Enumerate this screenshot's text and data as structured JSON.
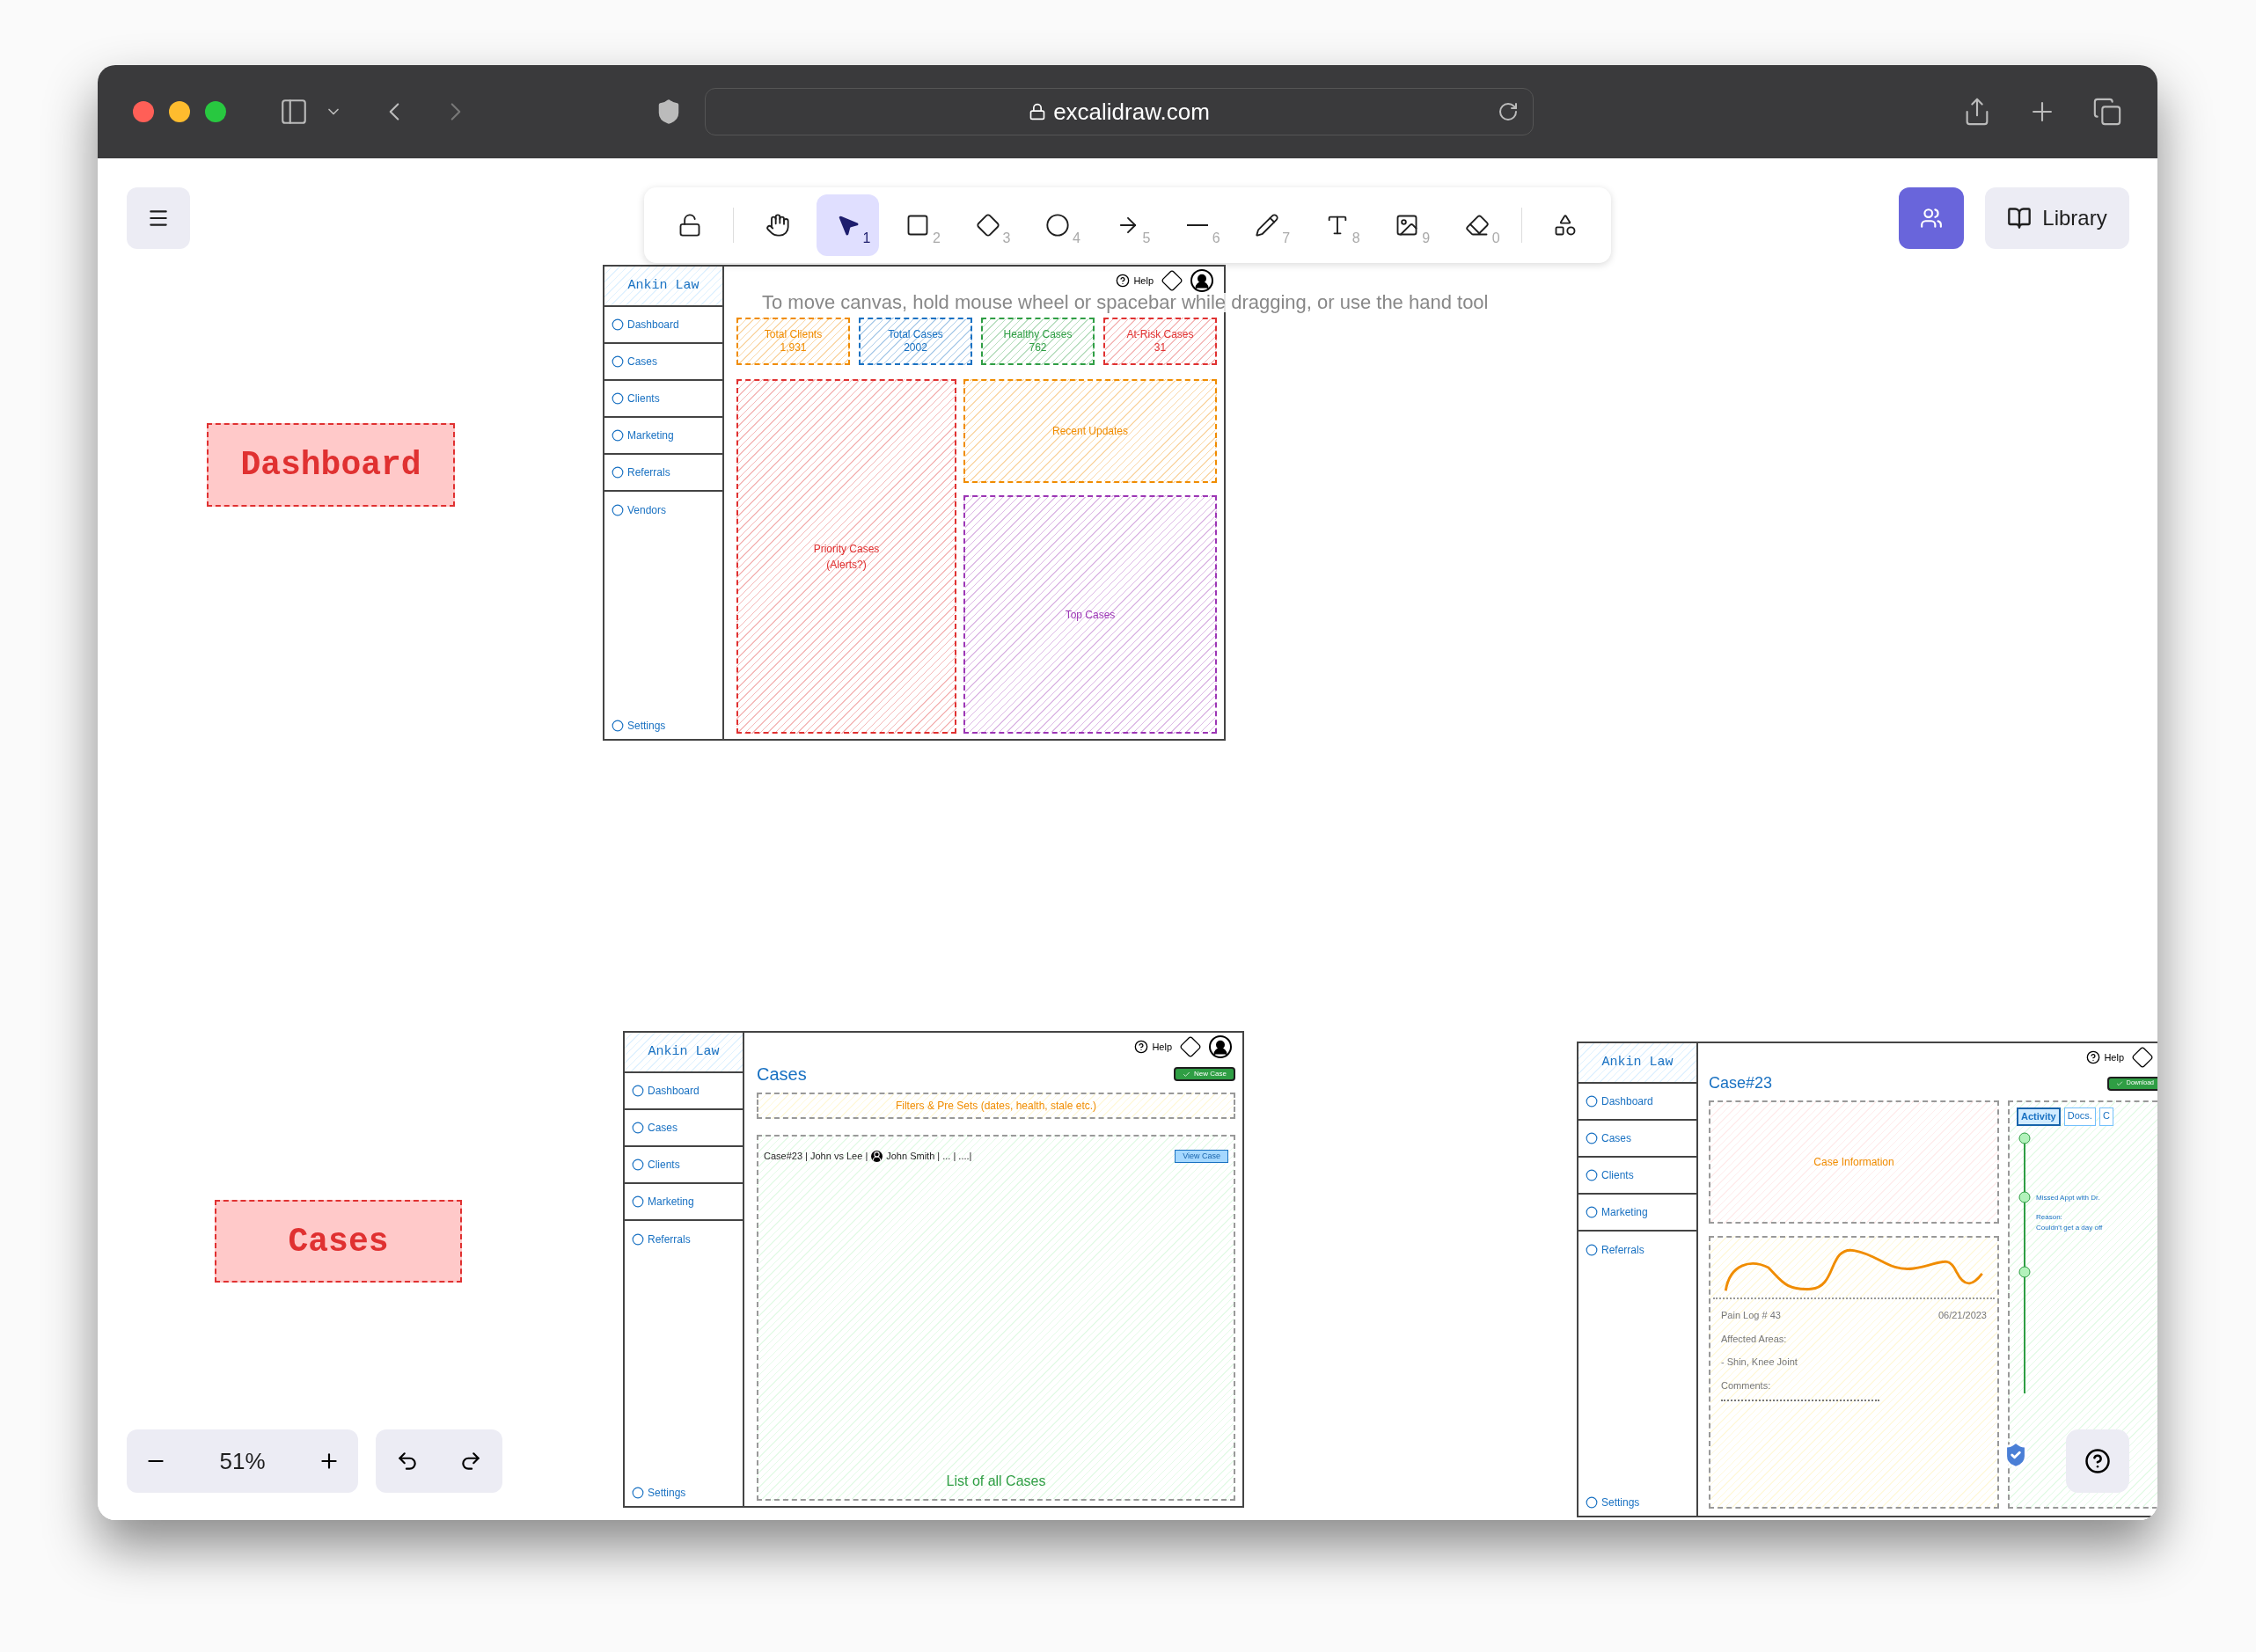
{
  "browser": {
    "url": "excalidraw.com"
  },
  "toolbar": {
    "tools": [
      {
        "kind": "lock",
        "selected": false
      },
      {
        "kind": "hand",
        "selected": false
      },
      {
        "kind": "select",
        "shortcut": "1",
        "selected": true
      },
      {
        "kind": "rectangle",
        "shortcut": "2",
        "selected": false
      },
      {
        "kind": "diamond",
        "shortcut": "3",
        "selected": false
      },
      {
        "kind": "ellipse",
        "shortcut": "4",
        "selected": false
      },
      {
        "kind": "arrow",
        "shortcut": "5",
        "selected": false
      },
      {
        "kind": "line",
        "shortcut": "6",
        "selected": false
      },
      {
        "kind": "pencil",
        "shortcut": "7",
        "selected": false
      },
      {
        "kind": "text",
        "shortcut": "8",
        "selected": false
      },
      {
        "kind": "image",
        "shortcut": "9",
        "selected": false
      },
      {
        "kind": "eraser",
        "shortcut": "0",
        "selected": false
      },
      {
        "kind": "shapes",
        "selected": false
      }
    ]
  },
  "library_button": "Library",
  "hint": "To move canvas, hold mouse wheel or spacebar while dragging, or use the hand tool",
  "labels": [
    {
      "text": "Dashboard"
    },
    {
      "text": "Cases"
    }
  ],
  "frames": [
    {
      "kind": "dashboard",
      "brand": "Ankin Law",
      "nav": [
        "Dashboard",
        "Cases",
        "Clients",
        "Marketing",
        "Referrals",
        "Vendors"
      ],
      "settings": "Settings",
      "help": "Help",
      "stats": [
        {
          "title": "Total Clients",
          "value": "1,931",
          "color": "#f08c00"
        },
        {
          "title": "Total Cases",
          "value": "2002",
          "color": "#1971c2"
        },
        {
          "title": "Healthy Cases",
          "value": "762",
          "color": "#2f9e44"
        },
        {
          "title": "At-Risk Cases",
          "value": "31",
          "color": "#e03131"
        }
      ],
      "panels": [
        {
          "text": "Priority Cases",
          "note": "(Alerts?)",
          "color": "#e03131"
        },
        {
          "text": "Recent Updates",
          "color": "#f08c00"
        },
        {
          "text": "Top Cases",
          "color": "#9c36b5"
        }
      ]
    },
    {
      "kind": "cases",
      "brand": "Ankin Law",
      "nav": [
        "Dashboard",
        "Cases",
        "Clients",
        "Marketing",
        "Referrals"
      ],
      "settings": "Settings",
      "help": "Help",
      "title": "Cases",
      "new_button": "New Case",
      "filters": "Filters & Pre Sets (dates, health, stale etc.)",
      "row_case": "Case#23 | John vs Lee |",
      "row_client": "John Smith | ... | ....|",
      "view_button": "View Case",
      "list_caption": "List of all Cases"
    },
    {
      "kind": "case",
      "brand": "Ankin Law",
      "nav": [
        "Dashboard",
        "Cases",
        "Clients",
        "Marketing",
        "Referrals"
      ],
      "settings": "Settings",
      "help": "Help",
      "title": "Case#23",
      "download": "Download",
      "info": "Case Information",
      "log_title": "Pain Log # 43",
      "log_date": "06/21/2023",
      "areas_label": "Affected Areas:",
      "areas": "- Shin, Knee Joint",
      "comments_label": "Comments:",
      "tabs": [
        {
          "label": "Activity",
          "selected": true
        },
        {
          "label": "Docs.",
          "selected": false
        },
        {
          "label": "C",
          "selected": false
        }
      ],
      "activity": "Missed Appt with Dr.",
      "reason_label": "Reason:",
      "reason": "Couldn't get a day off"
    }
  ],
  "zoom": "51%"
}
